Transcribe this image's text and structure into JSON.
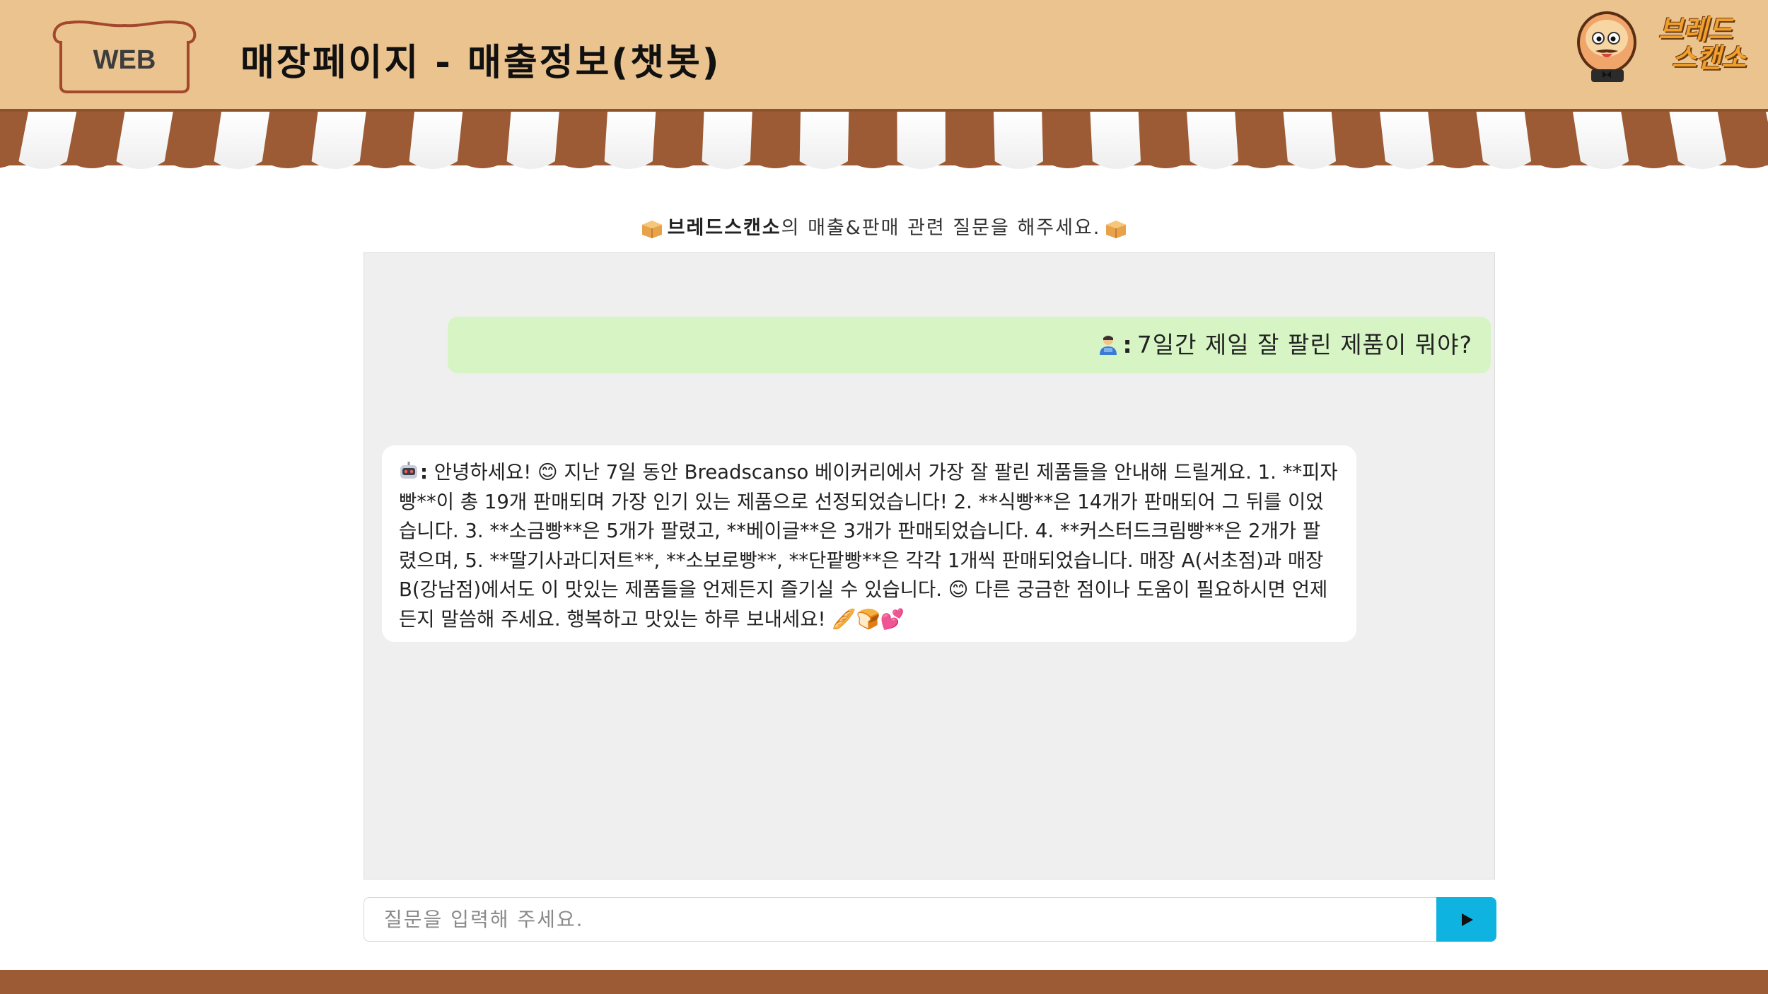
{
  "header": {
    "badge": "WEB",
    "title": "매장페이지 - 매출정보(챗봇)",
    "brand_line1": "브레드",
    "brand_line2": "스캔소"
  },
  "intro": {
    "brand": "브레드스캔소",
    "rest": "의 매출&판매 관련 질문을 해주세요."
  },
  "chat": {
    "messages": [
      {
        "role": "user",
        "prefix": ":",
        "text": "7일간 제일 잘 팔린 제품이 뭐야?"
      },
      {
        "role": "bot",
        "prefix": ":",
        "text": "안녕하세요! 😊 지난 7일 동안 Breadscanso 베이커리에서 가장 잘 팔린 제품들을 안내해 드릴게요. 1. **피자빵**이 총 19개 판매되며 가장 인기 있는 제품으로 선정되었습니다! 2. **식빵**은 14개가 판매되어 그 뒤를 이었습니다. 3. **소금빵**은 5개가 팔렸고, **베이글**은 3개가 판매되었습니다. 4. **커스터드크림빵**은 2개가 팔렸으며, 5. **딸기사과디저트**, **소보로빵**, **단팥빵**은 각각 1개씩 판매되었습니다. 매장 A(서초점)과 매장 B(강남점)에서도 이 맛있는 제품들을 언제든지 즐기실 수 있습니다. 😊 다른 궁금한 점이나 도움이 필요하시면 언제든지 말씀해 주세요. 행복하고 맛있는 하루 보내세요! 🥖🍞💕"
      }
    ]
  },
  "input": {
    "placeholder": "질문을 입력해 주세요."
  },
  "colors": {
    "header_bg": "#ebc38f",
    "awning_brown": "#9c5b34",
    "user_bubble": "#d7f5c4",
    "send_button": "#0fb3e0"
  },
  "icons": [
    "web-badge-icon",
    "mascot-icon",
    "bread-box-icon",
    "user-avatar-icon",
    "robot-avatar-icon",
    "send-icon"
  ]
}
